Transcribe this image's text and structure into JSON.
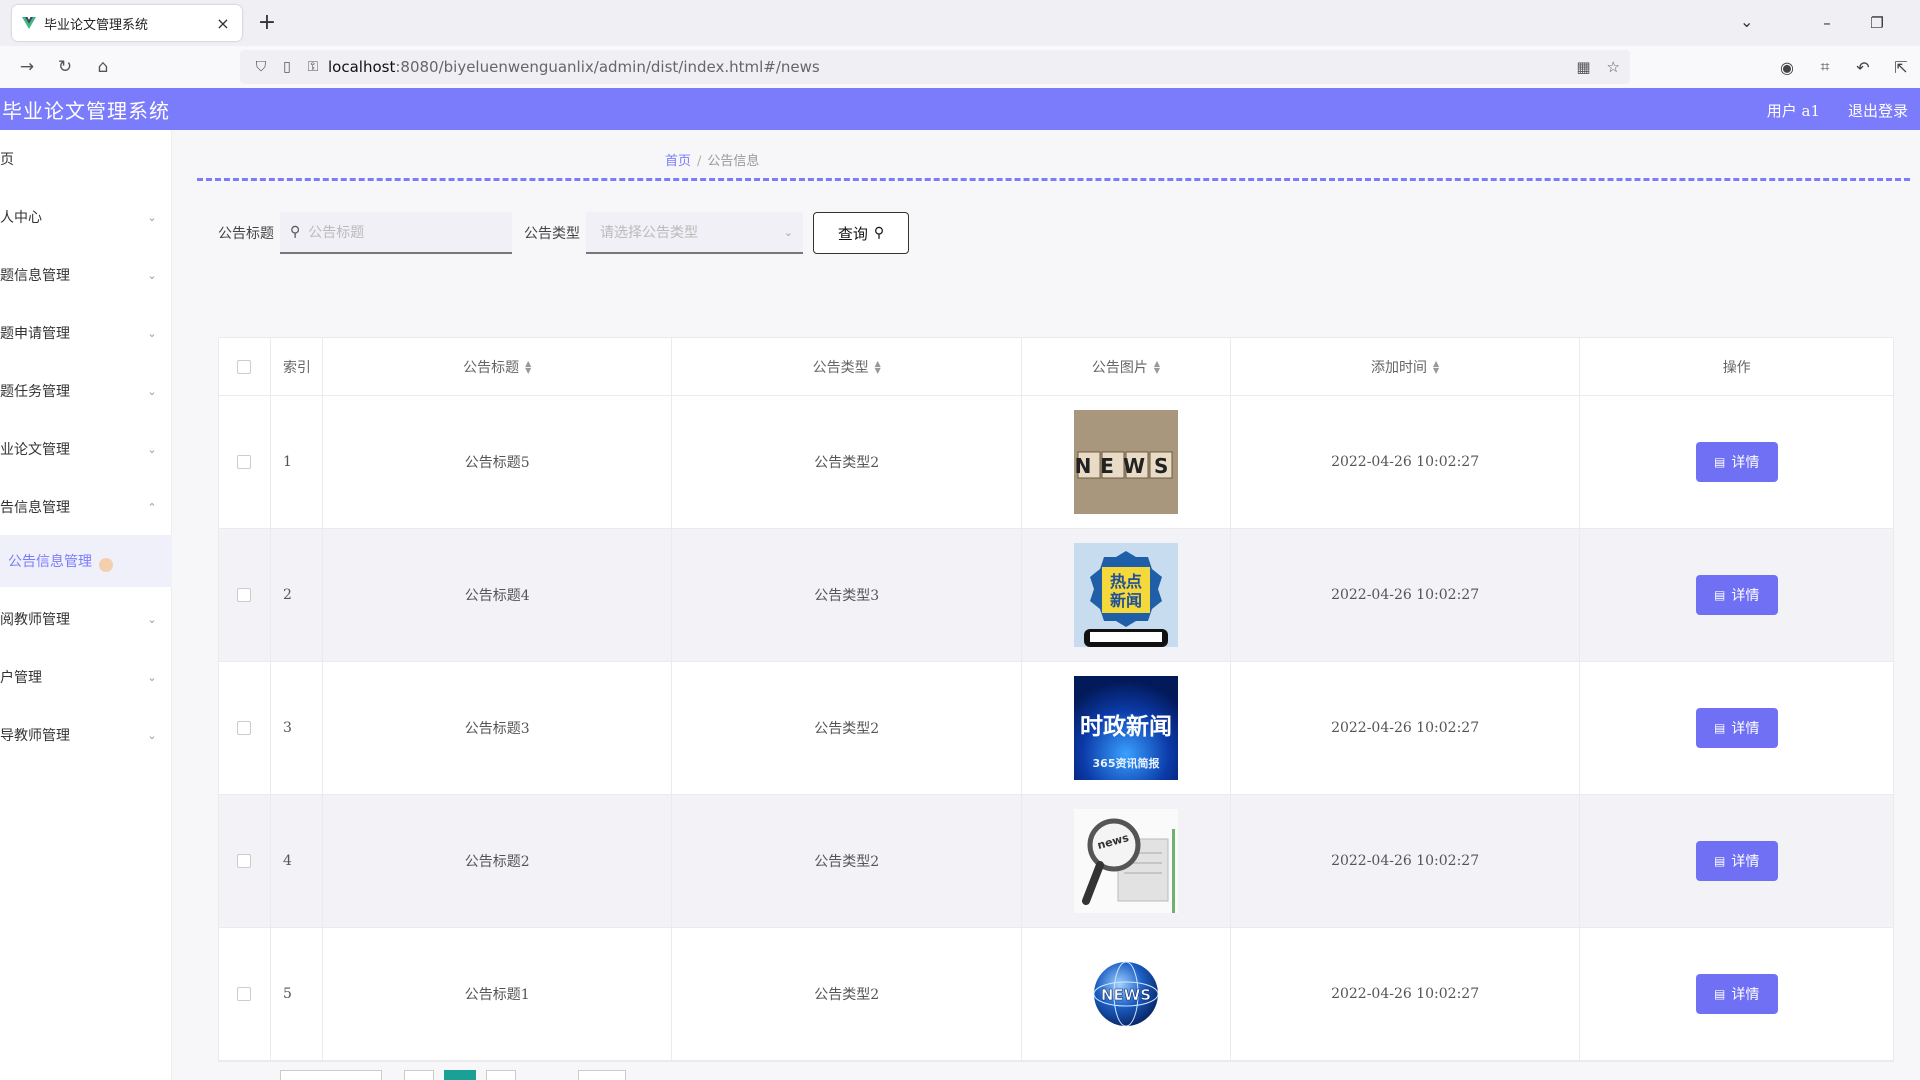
{
  "browser": {
    "tab_title": "毕业论文管理系统",
    "tab_close": "×",
    "new_tab": "+",
    "url_host": "localhost",
    "url_rest": ":8080/biyeluenwenguanlix/admin/dist/index.html#/news"
  },
  "header": {
    "title": "毕业论文管理系统",
    "user": "用户 a1",
    "logout": "退出登录"
  },
  "sidebar": {
    "items": [
      {
        "label": "页",
        "arrow": ""
      },
      {
        "label": "人中心",
        "arrow": "⌄"
      },
      {
        "label": "题信息管理",
        "arrow": "⌄"
      },
      {
        "label": "题申请管理",
        "arrow": "⌄"
      },
      {
        "label": "题任务管理",
        "arrow": "⌄"
      },
      {
        "label": "业论文管理",
        "arrow": "⌄"
      },
      {
        "label": "告信息管理",
        "arrow": "⌃"
      },
      {
        "label": "阅教师管理",
        "arrow": "⌄"
      },
      {
        "label": "户管理",
        "arrow": "⌄"
      },
      {
        "label": "导教师管理",
        "arrow": "⌄"
      }
    ],
    "active_sub": "公告信息管理"
  },
  "breadcrumb": {
    "home": "首页",
    "sep": "/",
    "current": "公告信息"
  },
  "search": {
    "title_label": "公告标题",
    "title_placeholder": "公告标题",
    "type_label": "公告类型",
    "type_placeholder": "请选择公告类型",
    "query_button": "查询"
  },
  "table": {
    "headers": {
      "index": "索引",
      "title": "公告标题",
      "type": "公告类型",
      "image": "公告图片",
      "time": "添加时间",
      "actions": "操作"
    },
    "rows": [
      {
        "index": "1",
        "title": "公告标题5",
        "type": "公告类型2",
        "image": "news-blocks-image",
        "time": "2022-04-26 10:02:27",
        "action": "详情"
      },
      {
        "index": "2",
        "title": "公告标题4",
        "type": "公告类型3",
        "image": "hot-news-phone-image",
        "time": "2022-04-26 10:02:27",
        "action": "详情"
      },
      {
        "index": "3",
        "title": "公告标题3",
        "type": "公告类型2",
        "image": "politics-news-image",
        "time": "2022-04-26 10:02:27",
        "action": "详情"
      },
      {
        "index": "4",
        "title": "公告标题2",
        "type": "公告类型2",
        "image": "magnifier-news-image",
        "time": "2022-04-26 10:02:27",
        "action": "详情"
      },
      {
        "index": "5",
        "title": "公告标题1",
        "type": "公告类型2",
        "image": "globe-news-image",
        "time": "2022-04-26 10:02:27",
        "action": "详情"
      }
    ]
  },
  "image_text": {
    "img1": "NEWS",
    "img2_line1": "热点",
    "img2_line2": "新闻",
    "img3_line1": "时政新闻",
    "img3_line2": "365资讯简报",
    "img4": "news",
    "img5": "NEWS"
  },
  "colors": {
    "accent": "#7a7cfc",
    "button": "#6f70f4",
    "pager_active": "#1aa094"
  }
}
